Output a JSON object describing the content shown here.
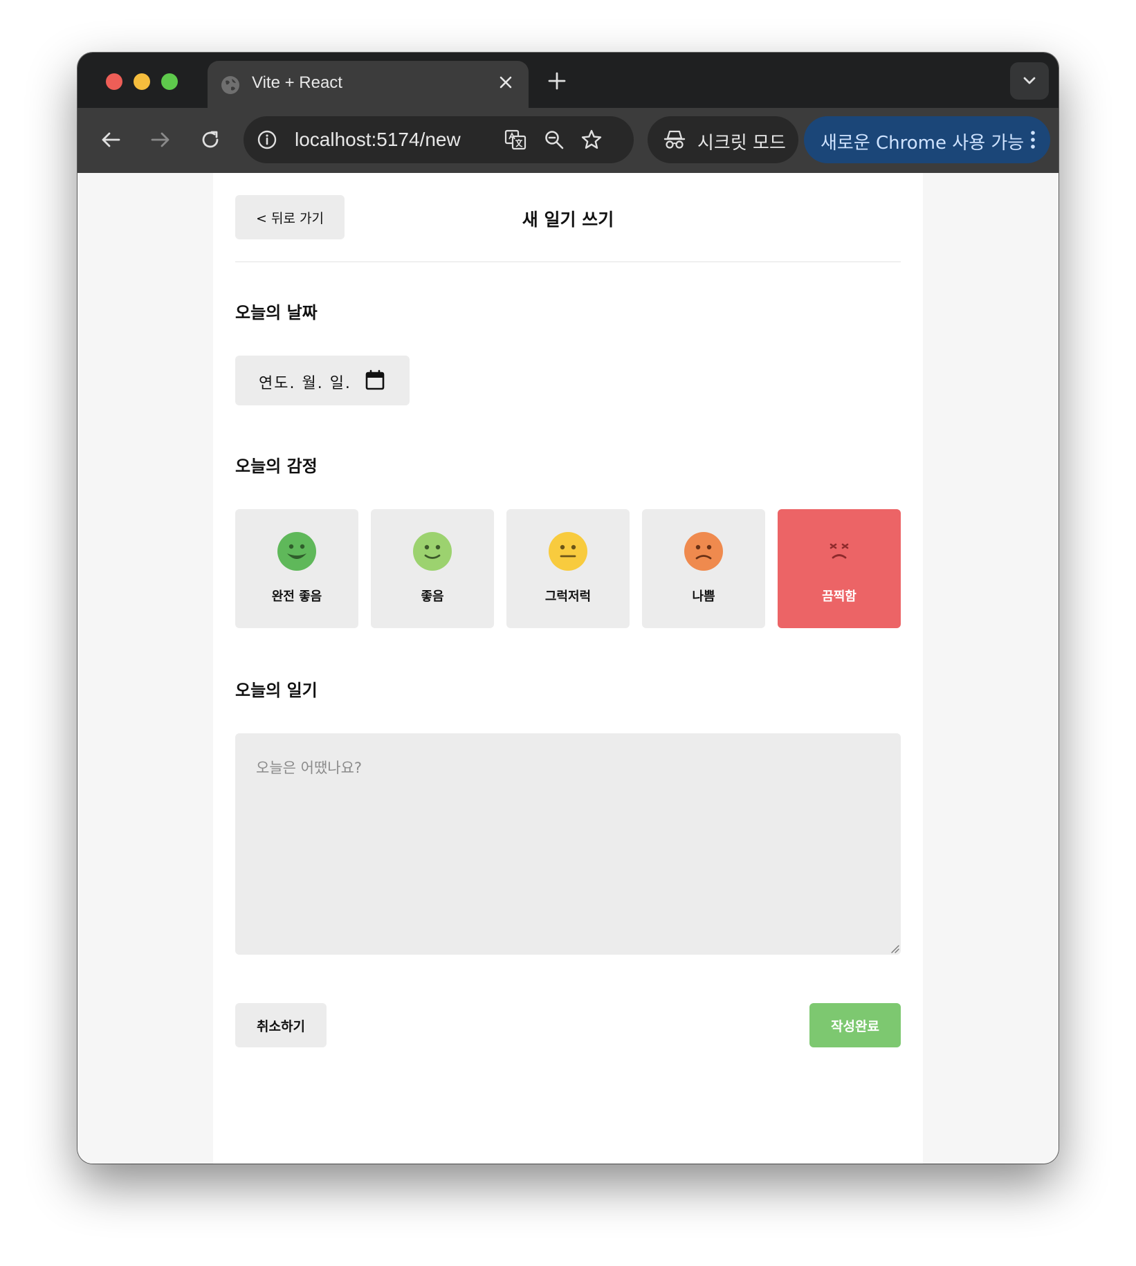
{
  "browser": {
    "tab_title": "Vite + React",
    "url": "localhost:5174/new",
    "incognito_label": "시크릿 모드",
    "update_label": "새로운 Chrome 사용 가능"
  },
  "header": {
    "back_label": "< 뒤로 가기",
    "title": "새 일기 쓰기"
  },
  "date_section": {
    "label": "오늘의 날짜",
    "date_placeholder": "연도. 월. 일."
  },
  "emotion_section": {
    "label": "오늘의 감정",
    "items": [
      {
        "label": "완전 좋음",
        "color": "#5fb85a",
        "selected": false
      },
      {
        "label": "좋음",
        "color": "#9cd26f",
        "selected": false
      },
      {
        "label": "그럭저럭",
        "color": "#f8cb3e",
        "selected": false
      },
      {
        "label": "나쁨",
        "color": "#ef8a4e",
        "selected": false
      },
      {
        "label": "끔찍함",
        "color": "#ec6466",
        "selected": true
      }
    ]
  },
  "diary_section": {
    "label": "오늘의 일기",
    "placeholder": "오늘은 어땠나요?"
  },
  "actions": {
    "cancel_label": "취소하기",
    "submit_label": "작성완료"
  },
  "colors": {
    "submit": "#7dc870",
    "selected_emotion": "#ec6466",
    "input_bg": "#ececec"
  }
}
